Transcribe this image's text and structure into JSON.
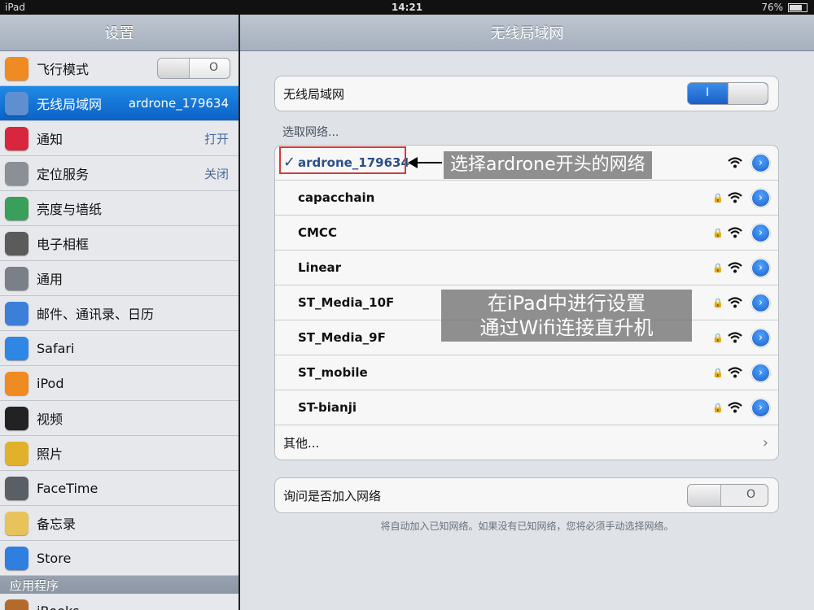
{
  "status": {
    "device": "iPad",
    "time": "14:21",
    "battery": "76%",
    "battery_level": 0.76
  },
  "master": {
    "title": "设置",
    "items": [
      {
        "label": "飞行模式",
        "icon": "airplane-icon",
        "color": "#f08a22",
        "accessory": "toggle",
        "toggle_text": "O"
      },
      {
        "label": "无线局域网",
        "icon": "wifi-icon",
        "color": "#5f8fd0",
        "value": "ardrone_179634",
        "selected": true
      },
      {
        "label": "通知",
        "icon": "notification-icon",
        "color": "#d7263d",
        "value": "打开"
      },
      {
        "label": "定位服务",
        "icon": "location-icon",
        "color": "#8b8f96",
        "value": "关闭"
      },
      {
        "label": "亮度与墙纸",
        "icon": "brightness-icon",
        "color": "#3a9f5a"
      },
      {
        "label": "电子相框",
        "icon": "picture-frame-icon",
        "color": "#5b5b5b"
      },
      {
        "label": "通用",
        "icon": "gear-icon",
        "color": "#7b8088"
      },
      {
        "label": "邮件、通讯录、日历",
        "icon": "mail-icon",
        "color": "#3c7fd8"
      },
      {
        "label": "Safari",
        "icon": "safari-icon",
        "color": "#2e86e5"
      },
      {
        "label": "iPod",
        "icon": "ipod-icon",
        "color": "#f08a22"
      },
      {
        "label": "视频",
        "icon": "video-icon",
        "color": "#222222"
      },
      {
        "label": "照片",
        "icon": "photos-icon",
        "color": "#e1b12c"
      },
      {
        "label": "FaceTime",
        "icon": "facetime-icon",
        "color": "#5a5f66"
      },
      {
        "label": "备忘录",
        "icon": "notes-icon",
        "color": "#e8c35b"
      },
      {
        "label": "Store",
        "icon": "store-icon",
        "color": "#2f7fe0"
      }
    ],
    "section_header": "应用程序",
    "next_item": {
      "label": "iBooks",
      "icon": "ibooks-icon",
      "color": "#b46a2b"
    }
  },
  "detail": {
    "title": "无线局域网",
    "wifi_row": {
      "label": "无线局域网",
      "toggle": "I"
    },
    "choose_label": "选取网络...",
    "networks": [
      {
        "name": "ardrone_179634",
        "selected": true,
        "secure": false
      },
      {
        "name": "capacchain",
        "secure": true
      },
      {
        "name": "CMCC",
        "secure": true
      },
      {
        "name": "Linear",
        "secure": true
      },
      {
        "name": "ST_Media_10F",
        "secure": true
      },
      {
        "name": "ST_Media_9F",
        "secure": true
      },
      {
        "name": "ST_mobile",
        "secure": true
      },
      {
        "name": "ST-bianji",
        "secure": true
      }
    ],
    "other_label": "其他...",
    "ask_row": {
      "label": "询问是否加入网络",
      "toggle": "O"
    },
    "footnote": "将自动加入已知网络。如果没有已知网络，您将必须手动选择网络。"
  },
  "annotations": {
    "callout": "选择ardrone开头的网络",
    "box_line1": "在iPad中进行设置",
    "box_line2": "通过Wifi连接直升机"
  }
}
